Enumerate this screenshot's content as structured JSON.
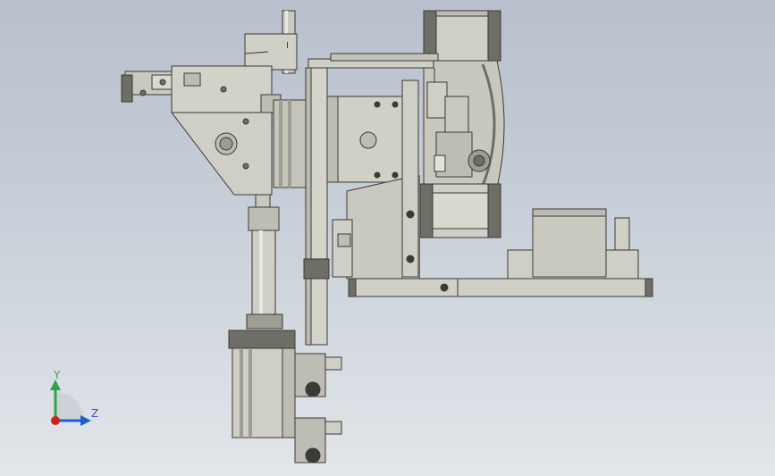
{
  "viewport": {
    "background_top": "#b7c0cc",
    "background_bottom": "#e3e6ea",
    "part_fill": "#d2d2c8",
    "part_shade": "#b9b9ae",
    "part_dark": "#6e6e66",
    "edge_color": "#3a3a36"
  },
  "model": {
    "marker_label": "I"
  },
  "triad": {
    "y_axis_label": "Y",
    "z_axis_label": "Z",
    "y_axis_color": "#2fa34a",
    "z_axis_color": "#1f5fd0",
    "x_origin_color": "#d02020"
  }
}
